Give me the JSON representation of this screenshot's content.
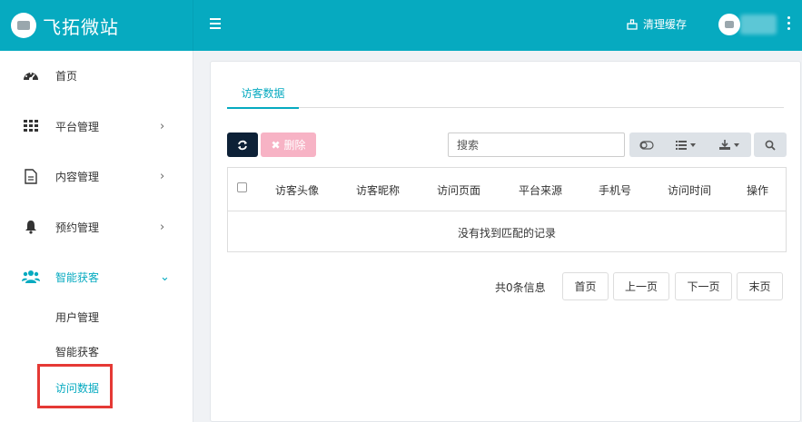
{
  "header": {
    "brand_title": "飞拓微站",
    "clear_cache_label": "清理缓存"
  },
  "sidebar": {
    "items": [
      {
        "label": "首页",
        "icon": "dashboard-icon"
      },
      {
        "label": "平台管理",
        "icon": "grid-icon",
        "arrow": "›"
      },
      {
        "label": "内容管理",
        "icon": "document-icon",
        "arrow": "›"
      },
      {
        "label": "预约管理",
        "icon": "bell-icon",
        "arrow": "›"
      },
      {
        "label": "智能获客",
        "icon": "users-icon",
        "arrow": "⌄"
      }
    ],
    "subitems": [
      "用户管理",
      "智能获客",
      "访问数据"
    ]
  },
  "main": {
    "tab_label": "访客数据",
    "delete_label": "删除",
    "search_placeholder": "搜索",
    "columns": [
      "访客头像",
      "访客昵称",
      "访问页面",
      "平台来源",
      "手机号",
      "访问时间",
      "操作"
    ],
    "empty_text": "没有找到匹配的记录",
    "pagination": {
      "total_info": "共0条信息",
      "first": "首页",
      "prev": "上一页",
      "next": "下一页",
      "last": "末页"
    }
  },
  "colors": {
    "accent": "#06aac0",
    "dark_button": "#0d2137",
    "delete_button": "#f7b3c5",
    "highlight_border": "#e53935"
  }
}
